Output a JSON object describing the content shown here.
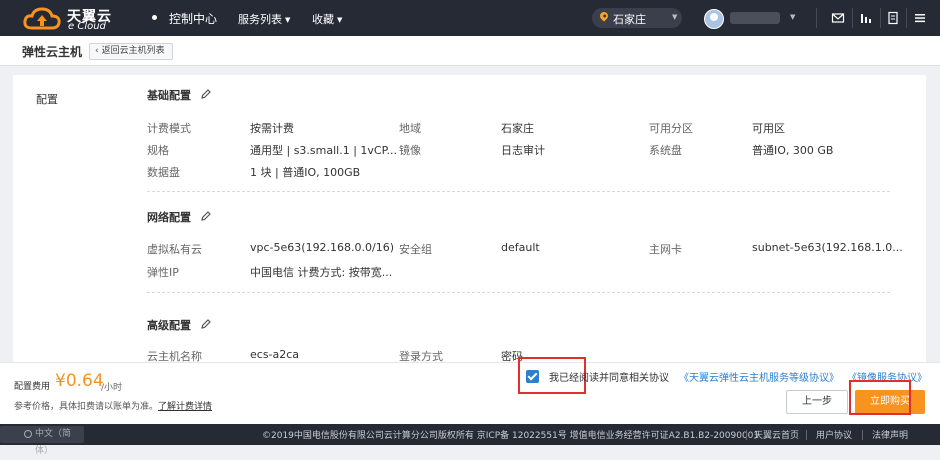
{
  "topbar": {
    "logo_cn": "天翼云",
    "logo_en": "e Cloud",
    "nav": [
      {
        "label": "控制中心"
      },
      {
        "label": "服务列表"
      },
      {
        "label": "收藏"
      }
    ],
    "region": "石家庄"
  },
  "header": {
    "title": "弹性云主机",
    "back_label": "返回云主机列表"
  },
  "config": {
    "label": "配置",
    "basic": {
      "title": "基础配置",
      "fields": [
        {
          "k": "计费模式",
          "v": "按需计费"
        },
        {
          "k": "地域",
          "v": "石家庄"
        },
        {
          "k": "可用分区",
          "v": "可用区"
        },
        {
          "k": "规格",
          "v": "通用型 | s3.small.1 | 1vCP..."
        },
        {
          "k": "镜像",
          "v": "日志审计"
        },
        {
          "k": "系统盘",
          "v": "普通IO, 300 GB"
        },
        {
          "k": "数据盘",
          "v": "1 块 | 普通IO, 100GB"
        }
      ]
    },
    "network": {
      "title": "网络配置",
      "fields": [
        {
          "k": "虚拟私有云",
          "v": "vpc-5e63(192.168.0.0/16)"
        },
        {
          "k": "安全组",
          "v": "default"
        },
        {
          "k": "主网卡",
          "v": "subnet-5e63(192.168.1.0..."
        },
        {
          "k": "弹性IP",
          "v": "中国电信 计费方式: 按带宽..."
        }
      ]
    },
    "advanced": {
      "title": "高级配置",
      "fields": [
        {
          "k": "云主机名称",
          "v": "ecs-a2ca"
        },
        {
          "k": "登录方式",
          "v": "密码"
        }
      ]
    }
  },
  "footer": {
    "fee_label": "配置费用",
    "fee_amount": "¥0.64",
    "fee_unit": "/小时",
    "fee_note": "参考价格，具体扣费请以账单为准。",
    "fee_link": "了解计费详情",
    "agree_text": "我已经阅读并同意相关协议",
    "agree_link1": "《天翼云弹性云主机服务等级协议》",
    "agree_link2": "《镜像服务协议》",
    "prev_label": "上一步",
    "buy_label": "立即购买"
  },
  "bottombar": {
    "lang": "中文（简体）",
    "copyright": "©2019中国电信股份有限公司云计算分公司版权所有   京ICP备 12022551号   增值电信业务经营许可证A2.B1.B2-20090001",
    "links": [
      "天翼云首页",
      "用户协议",
      "法律声明"
    ]
  },
  "colors": {
    "topbar": "#262a35",
    "accent": "#f7931e",
    "link": "#2b7fd0",
    "highlight": "#e0302d"
  }
}
